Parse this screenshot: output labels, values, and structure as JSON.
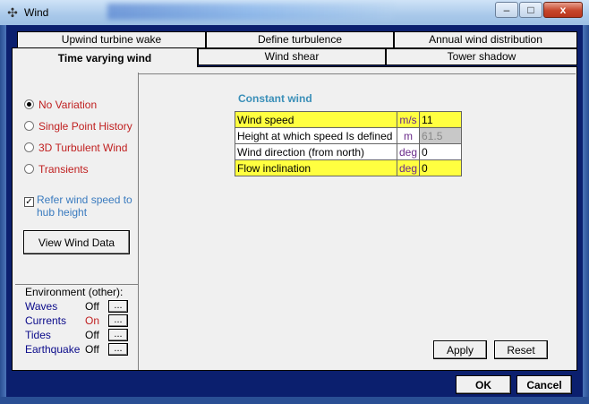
{
  "window": {
    "title": "Wind",
    "icon": "wind-turbine-icon",
    "min_label": "–",
    "max_label": "□",
    "close_label": "x"
  },
  "tabs_back": [
    {
      "label": "Upwind turbine wake"
    },
    {
      "label": "Define turbulence"
    },
    {
      "label": "Annual wind distribution"
    }
  ],
  "tabs_front": [
    {
      "label": "Time varying wind",
      "active": true
    },
    {
      "label": "Wind shear"
    },
    {
      "label": "Tower shadow"
    }
  ],
  "variation": {
    "options": [
      {
        "label": "No Variation",
        "selected": true
      },
      {
        "label": "Single Point History"
      },
      {
        "label": "3D Turbulent Wind"
      },
      {
        "label": "Transients"
      }
    ],
    "refer_checkbox": {
      "label": "Refer wind speed to hub height",
      "checked": true,
      "mark": "✓"
    },
    "view_button": "View Wind Data"
  },
  "environment": {
    "title": "Environment (other):",
    "rows": [
      {
        "label": "Waves",
        "value": "Off",
        "button": "..."
      },
      {
        "label": "Currents",
        "value": "On",
        "button": "..."
      },
      {
        "label": "Tides",
        "value": "Off",
        "button": "..."
      },
      {
        "label": "Earthquake",
        "value": "Off",
        "button": "..."
      }
    ]
  },
  "constant_wind": {
    "title": "Constant wind",
    "rows": [
      {
        "label": "Wind speed",
        "unit": "m/s",
        "value": "11"
      },
      {
        "label": "Height at which speed Is defined",
        "unit": "m",
        "value": "61.5"
      },
      {
        "label": "Wind direction (from north)",
        "unit": "deg",
        "value": "0"
      },
      {
        "label": "Flow inclination",
        "unit": "deg",
        "value": "0"
      }
    ]
  },
  "actions": {
    "apply": "Apply",
    "reset": "Reset",
    "ok": "OK",
    "cancel": "Cancel"
  },
  "colors": {
    "highlight": "#ffff40",
    "dialog_border": "#0b1f6e",
    "section_title": "#3a8fb8"
  }
}
